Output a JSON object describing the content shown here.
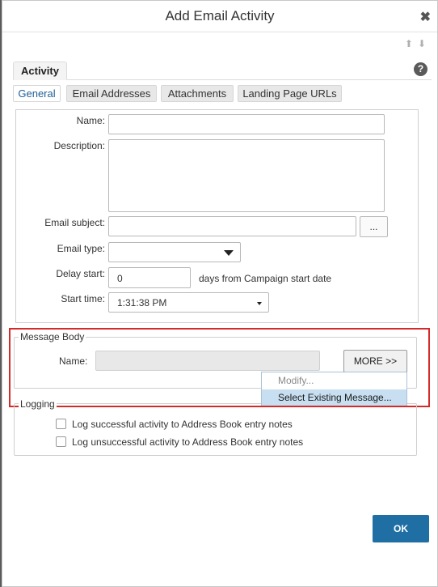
{
  "window": {
    "title": "Add Email Activity",
    "close_icon": "close-icon",
    "nav_icons": [
      "arrow-up-icon",
      "arrow-down-icon"
    ]
  },
  "tabs": {
    "main": "Activity",
    "help_icon": "?"
  },
  "subtabs": [
    "General",
    "Email Addresses",
    "Attachments",
    "Landing Page URLs"
  ],
  "form": {
    "name_label": "Name:",
    "description_label": "Description:",
    "email_subject_label": "Email subject:",
    "browse_button": "...",
    "email_type_label": "Email type:",
    "email_type_value": "",
    "delay_start_label": "Delay start:",
    "delay_start_value": "0",
    "delay_suffix": "days from Campaign start date",
    "start_time_label": "Start time:",
    "start_time_value": "1:31:38 PM"
  },
  "message_body": {
    "legend": "Message Body",
    "name_label": "Name:",
    "more_button": "MORE >>",
    "menu": [
      {
        "label": "Modify...",
        "enabled": false
      },
      {
        "label": "Select Existing Message...",
        "enabled": true,
        "highlighted": true
      }
    ]
  },
  "logging": {
    "legend": "Logging",
    "options": [
      {
        "label": "Log successful activity to Address Book entry notes",
        "checked": false
      },
      {
        "label": "Log unsuccessful activity to Address Book entry notes",
        "checked": false
      }
    ]
  },
  "footer": {
    "ok_button": "OK"
  },
  "colors": {
    "accent": "#1f6fa5",
    "highlight_box": "#d42a2a",
    "menu_selected": "#c7dff0"
  }
}
